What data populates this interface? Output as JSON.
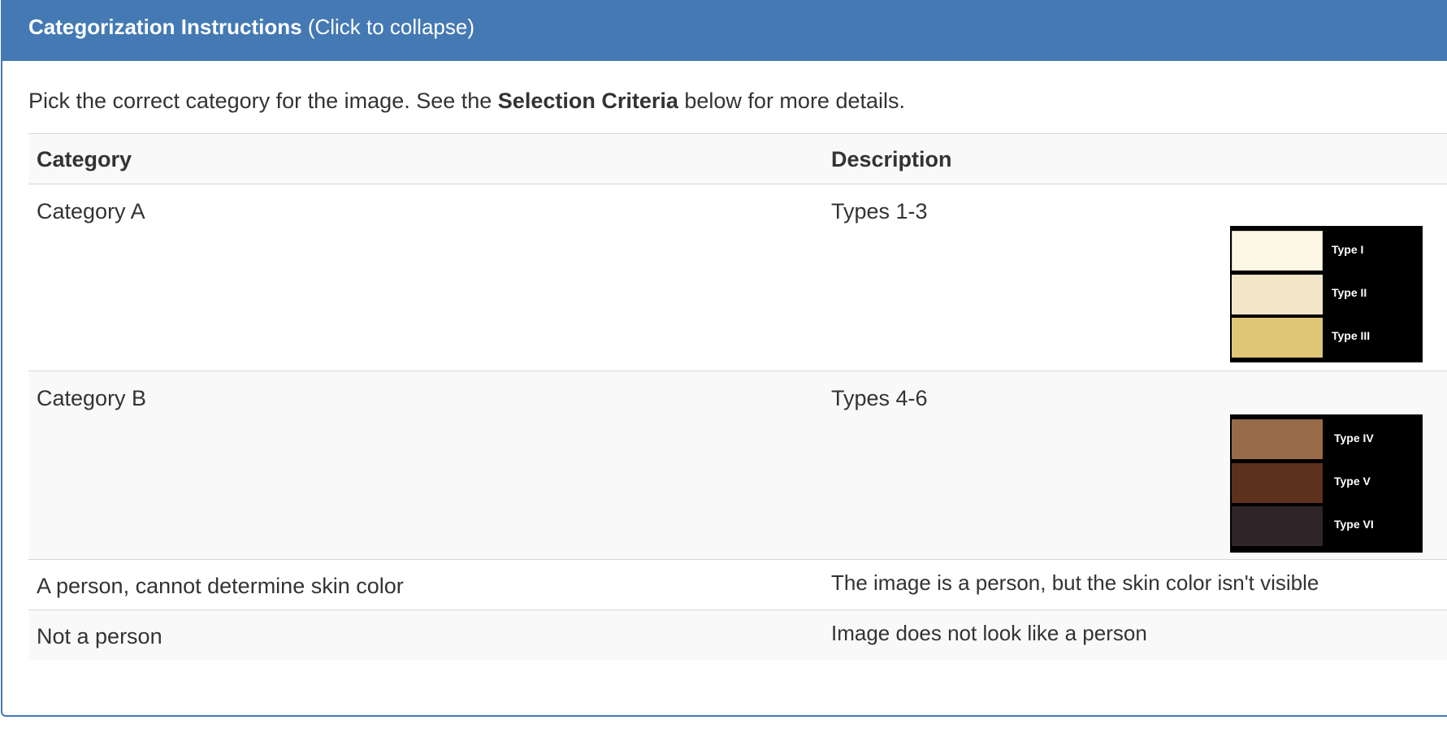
{
  "panel": {
    "heading_title": "Categorization Instructions",
    "heading_hint": "(Click to collapse)",
    "accent_color": "#4479b3"
  },
  "intro": {
    "text_before": "Pick the correct category for the image. See the ",
    "bold": "Selection Criteria",
    "text_after": " below for more details."
  },
  "table": {
    "headers": [
      "Category",
      "Description"
    ],
    "rows": [
      {
        "category": "Category A",
        "description": "Types 1-3",
        "swatches": [
          {
            "label": "Type I",
            "color": "#fdf7e6"
          },
          {
            "label": "Type II",
            "color": "#f1e6c7"
          },
          {
            "label": "Type III",
            "color": "#dfc677"
          }
        ]
      },
      {
        "category": "Category B",
        "description": "Types 4-6",
        "swatches": [
          {
            "label": "Type IV",
            "color": "#976a48"
          },
          {
            "label": "Type V",
            "color": "#5c311e"
          },
          {
            "label": "Type VI",
            "color": "#2f2528"
          }
        ]
      },
      {
        "category": "A person, cannot determine skin color",
        "description": "The image is a person, but the skin color isn't visible"
      },
      {
        "category": "Not a person",
        "description": "Image does not look like a person"
      }
    ]
  }
}
